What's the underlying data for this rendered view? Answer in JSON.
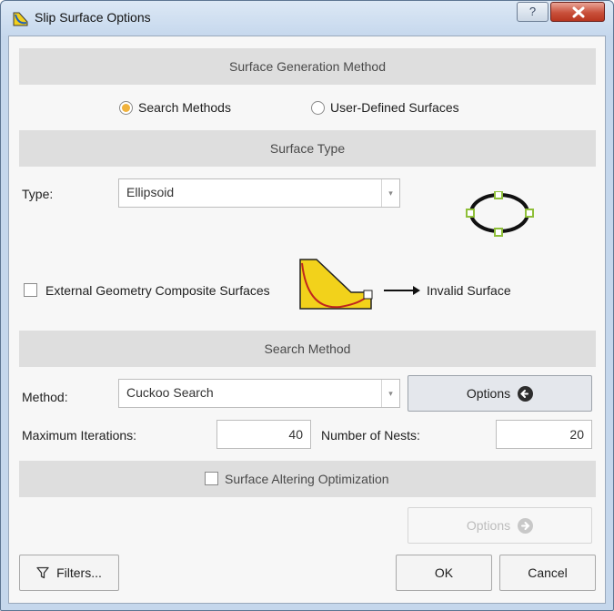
{
  "window": {
    "title": "Slip Surface Options",
    "help_glyph": "?"
  },
  "colors": {
    "accent_radio": "#f0b23c",
    "section_bg": "#dedede",
    "close_red": "#c9503b"
  },
  "surface_generation": {
    "header": "Surface Generation Method",
    "options": [
      {
        "label": "Search Methods",
        "selected": true
      },
      {
        "label": "User-Defined Surfaces",
        "selected": false
      }
    ]
  },
  "surface_type": {
    "header": "Surface Type",
    "type_label": "Type:",
    "type_value": "Ellipsoid",
    "external_geometry_label": "External Geometry Composite Surfaces",
    "external_geometry_checked": false,
    "invalid_label": "Invalid Surface"
  },
  "search_method": {
    "header": "Search Method",
    "method_label": "Method:",
    "method_value": "Cuckoo Search",
    "options_label": "Options",
    "max_iterations_label": "Maximum Iterations:",
    "max_iterations_value": "40",
    "nests_label": "Number of Nests:",
    "nests_value": "20"
  },
  "surface_altering": {
    "label": "Surface Altering Optimization",
    "checked": false,
    "options_label": "Options"
  },
  "footer": {
    "filters_label": "Filters...",
    "ok_label": "OK",
    "cancel_label": "Cancel"
  }
}
